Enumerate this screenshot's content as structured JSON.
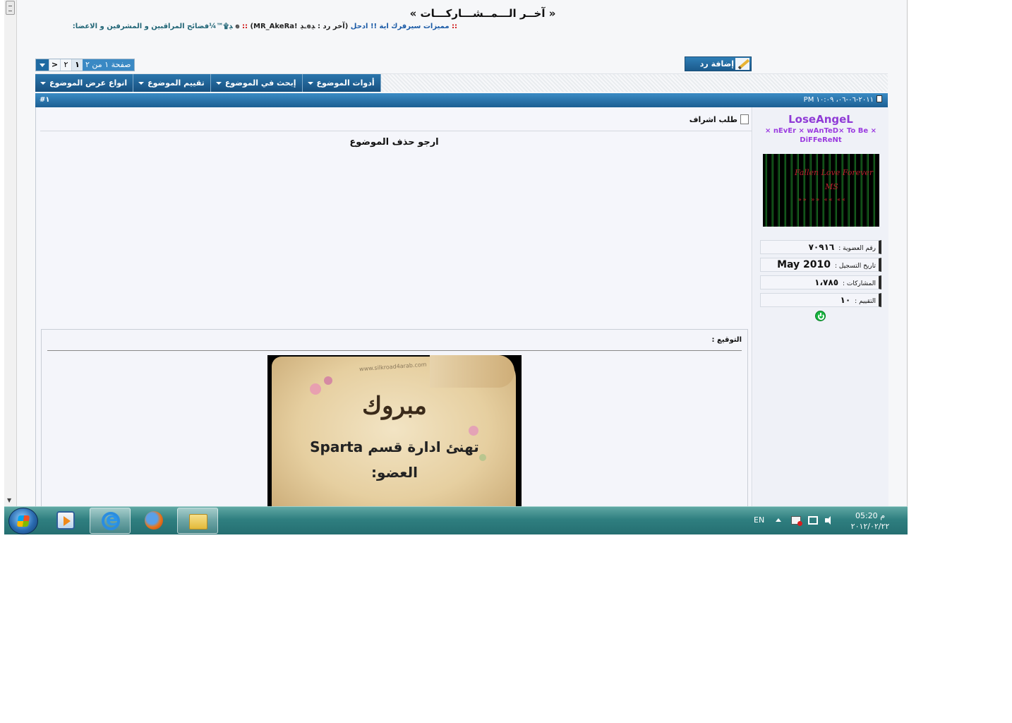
{
  "header": {
    "latest_posts_title": "« آخــر الـــمــشـــاركـــات »",
    "ticker": {
      "sep_left": "::",
      "item1": "مميزات سيرفرك اية !! ادحل",
      "item2": "(آخر رد :",
      "item3": "ﮃ๏ۦﮃ",
      "item4": "!๏",
      "sep_mid": "::",
      "item5": "(MR_AkeRa",
      "item6": "ﮃ۩™¼فضائح المراقبين و المشرفين و الاعضا:"
    }
  },
  "actions": {
    "add_reply": "إضافة رد"
  },
  "pagination": {
    "label": "صفحة ١ من ٢",
    "pages": [
      "١",
      "٢"
    ],
    "next": ">"
  },
  "thread_tools": [
    "أدوات الموضوع",
    "إبحث في الموضوع",
    "تقييم الموضوع",
    "انواع عرض الموضوع"
  ],
  "post": {
    "datetime": "٢٠١١-٠٦-٠٦، ١٠:٠٩ PM",
    "number": "#١",
    "title": "طلب اشراف",
    "message": "ارجو حذف الموضوع",
    "signature_label": "التوقيع :",
    "signature_image": {
      "url_text": "www.silkroad4arab.com",
      "headline": "مبروك",
      "line1": "تهنئ ادارة قسم Sparta",
      "line2": "العضو:"
    }
  },
  "user": {
    "username": "LoseAngeL",
    "title": "× nEvEr × wAnTeD× To Be × DiFFeReNt",
    "avatar_text_1": "Fallen Love Forever",
    "avatar_text_2": "MS",
    "avatar_text_3": "»» »» «« ««",
    "stats": {
      "member_label": "رقم العضوية :",
      "member_value": "٧٠٩١٦",
      "join_label": "تاريخ التسجيل :",
      "join_value": "May 2010",
      "posts_label": "المشاركات :",
      "posts_value": "١،٧٨٥",
      "rating_label": "التقييم :",
      "rating_value": "١٠"
    }
  },
  "taskbar": {
    "language": "EN",
    "time": "05:20 م",
    "date": "٢٠١٢/٠٢/٢٢"
  },
  "colors": {
    "accent_blue": "#1f6aa2",
    "username_purple": "#8f3ad6",
    "taskbar": "#2f7f80"
  },
  "icons": [
    "start-orb-icon",
    "media-player-icon",
    "internet-explorer-icon",
    "firefox-icon",
    "folder-icon",
    "flag-icon",
    "network-icon",
    "volume-icon",
    "pencil-icon",
    "page-icon",
    "online-status-icon"
  ]
}
